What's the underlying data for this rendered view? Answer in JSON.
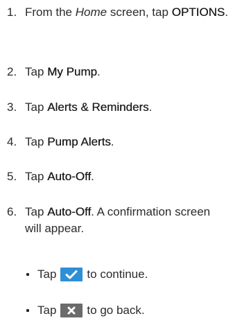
{
  "steps": [
    {
      "number": "1.",
      "parts": [
        {
          "text": "From the ",
          "style": "normal"
        },
        {
          "text": "Home",
          "style": "italic"
        },
        {
          "text": " screen, tap ",
          "style": "normal"
        },
        {
          "text": "OPTIONS",
          "style": "bold"
        },
        {
          "text": ".",
          "style": "normal"
        }
      ]
    },
    {
      "number": "2.",
      "parts": [
        {
          "text": "Tap ",
          "style": "normal"
        },
        {
          "text": "My Pump",
          "style": "bold"
        },
        {
          "text": ".",
          "style": "normal"
        }
      ]
    },
    {
      "number": "3.",
      "parts": [
        {
          "text": "Tap ",
          "style": "normal"
        },
        {
          "text": "Alerts & Reminders",
          "style": "bold"
        },
        {
          "text": ".",
          "style": "normal"
        }
      ]
    },
    {
      "number": "4.",
      "parts": [
        {
          "text": "Tap ",
          "style": "normal"
        },
        {
          "text": "Pump Alerts",
          "style": "bold"
        },
        {
          "text": ".",
          "style": "normal"
        }
      ]
    },
    {
      "number": "5.",
      "parts": [
        {
          "text": "Tap ",
          "style": "normal"
        },
        {
          "text": "Auto-Off",
          "style": "bold"
        },
        {
          "text": ".",
          "style": "normal"
        }
      ]
    },
    {
      "number": "6.",
      "parts": [
        {
          "text": "Tap ",
          "style": "normal"
        },
        {
          "text": "Auto-Off",
          "style": "bold"
        },
        {
          "text": ". A confirmation screen will appear.",
          "style": "normal"
        }
      ]
    }
  ],
  "sub_items": [
    {
      "before": "Tap",
      "icon": "checkmark-icon",
      "after": "to continue.",
      "icon_color": "#2f8fd6"
    },
    {
      "before": "Tap",
      "icon": "x-icon",
      "after": "to go back.",
      "icon_color": "#6b6b6b"
    }
  ]
}
